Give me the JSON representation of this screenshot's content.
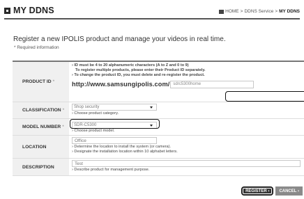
{
  "header": {
    "title": "MY DDNS",
    "breadcrumb": {
      "home": "HOME",
      "sep": ">",
      "middle": "DDNS Service",
      "current": "MY DDNS"
    }
  },
  "intro": {
    "heading": "Register a new IPOLIS product and manage your videos in real time.",
    "required": "* Required information"
  },
  "form": {
    "product_id": {
      "label": "PRODUCT ID",
      "star": "*",
      "note1": "› ID must be 4 to 20 alphanumeric characters (A to Z and 0 to 9)",
      "note2": "To register multiple products, please enter their Product ID separately.",
      "note3": "› To change the product ID, you must delete and re-register the product.",
      "url": "http://www.samsungipolis.com/",
      "value": "sdrc5300home"
    },
    "classification": {
      "label": "CLASSIFICATION",
      "star": "*",
      "value": "Shop security",
      "note": "› Choose product category."
    },
    "model_number": {
      "label": "MODEL NUMBER",
      "star": "*",
      "value": "SDR-C5300",
      "note": "› Choose product model."
    },
    "location": {
      "label": "LOCATION",
      "value": "Office",
      "note1": "› Determine the location to install the system (or camera).",
      "note2": "› Designate the installation location within 10 alphabet letters."
    },
    "description": {
      "label": "DESCRIPTION",
      "value": "Test",
      "note": "› Describe product for management purpose."
    }
  },
  "buttons": {
    "register": "REGISTER ›",
    "cancel": "CANCEL ›"
  }
}
